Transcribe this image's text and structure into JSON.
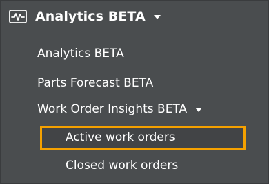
{
  "menu": {
    "header": {
      "icon": "activity-chart-icon",
      "title": "Analytics BETA"
    },
    "items": [
      {
        "label": "Analytics BETA"
      },
      {
        "label": "Parts Forecast BETA"
      },
      {
        "label": "Work Order Insights BETA"
      }
    ],
    "sub_items": [
      {
        "label": "Active work orders",
        "selected": true
      },
      {
        "label": "Closed work orders",
        "selected": false
      }
    ],
    "colors": {
      "background": "#4a4d4f",
      "text": "#ffffff",
      "selection_border": "#f5a100"
    }
  }
}
